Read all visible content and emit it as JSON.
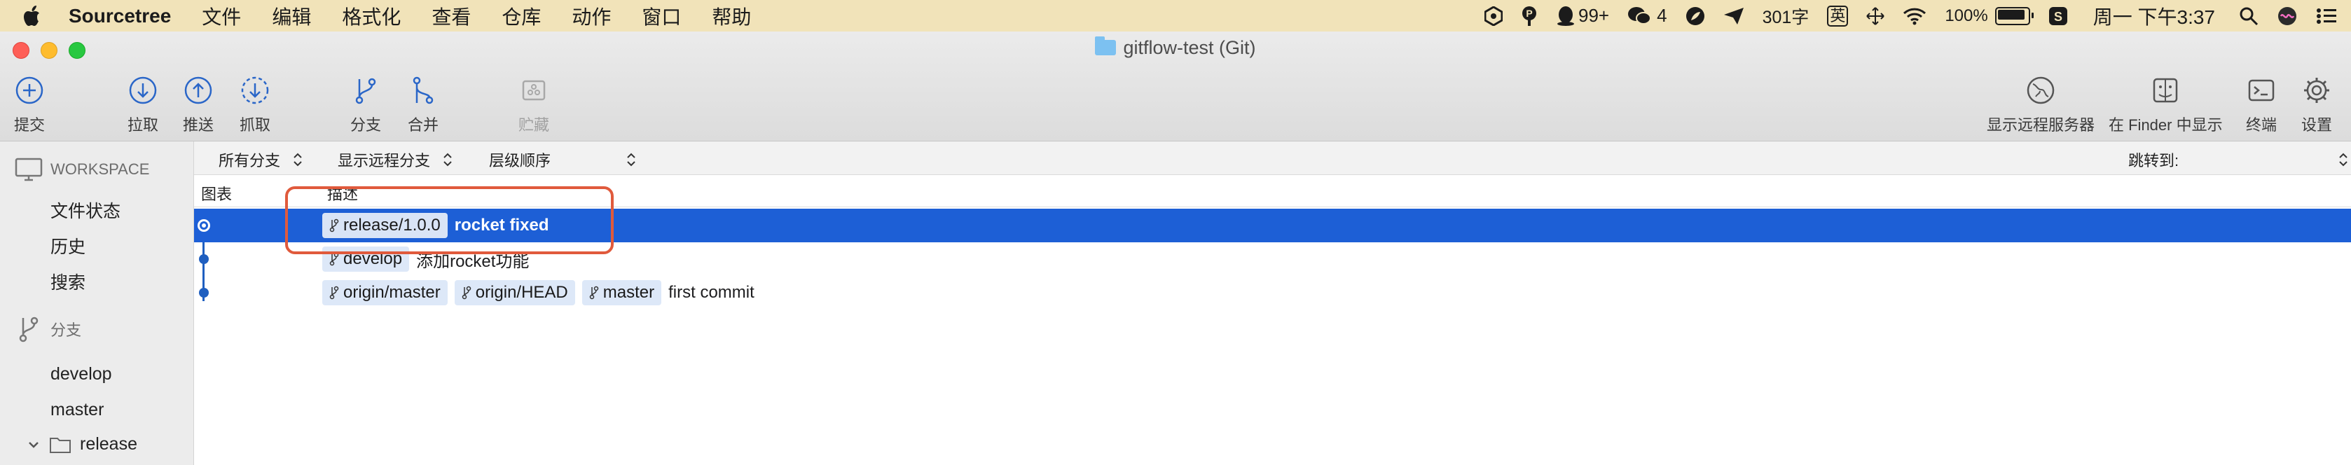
{
  "menubar": {
    "app_name": "Sourcetree",
    "items": [
      "文件",
      "编辑",
      "格式化",
      "查看",
      "仓库",
      "动作",
      "窗口",
      "帮助"
    ],
    "qq_badge": "99+",
    "wechat_badge": "4",
    "word_count": "301字",
    "input_method": "英",
    "battery": "100%",
    "battery_level": 1.0,
    "datetime": "周一 下午3:37"
  },
  "window": {
    "title": "gitflow-test (Git)"
  },
  "toolbar": {
    "commit": "提交",
    "pull": "拉取",
    "push": "推送",
    "fetch": "抓取",
    "branch": "分支",
    "merge": "合并",
    "stash": "贮藏",
    "show_remote": "显示远程服务器",
    "show_in_finder": "在 Finder 中显示",
    "terminal": "终端",
    "settings": "设置"
  },
  "sidebar": {
    "workspace_title": "WORKSPACE",
    "workspace_items": [
      "文件状态",
      "历史",
      "搜索"
    ],
    "branches_title": "分支",
    "branches": [
      "develop",
      "master"
    ],
    "folder_release": "release"
  },
  "filters": {
    "all_branches": "所有分支",
    "show_remote_branches": "显示远程分支",
    "order": "层级顺序",
    "jump_to": "跳转到:"
  },
  "columns": {
    "graph": "图表",
    "description": "描述"
  },
  "commits": [
    {
      "refs": [
        "release/1.0.0"
      ],
      "message": "rocket fixed",
      "selected": true
    },
    {
      "refs": [
        "develop"
      ],
      "message": "添加rocket功能",
      "selected": false
    },
    {
      "refs": [
        "origin/master",
        "origin/HEAD",
        "master"
      ],
      "message": "first commit",
      "selected": false
    }
  ],
  "colors": {
    "selection": "#1d5fd6",
    "graph": "#1f5fc0",
    "annotation": "#e05a3c",
    "menubar": "#f1e3b9"
  }
}
